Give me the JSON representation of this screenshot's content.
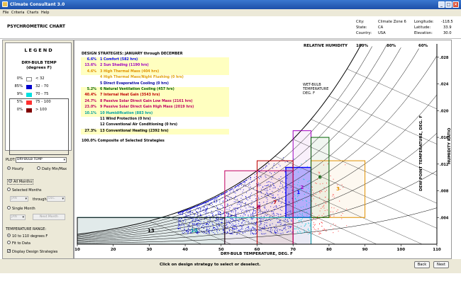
{
  "window": {
    "title": "Climate Consultant 3.0"
  },
  "menu": [
    "File",
    "Criteria",
    "Charts",
    "Help"
  ],
  "header": {
    "page_title": "PSYCHROMETRIC CHART",
    "city_label": "City:",
    "city": "Climate Zone 6",
    "state_label": "State:",
    "state": "CA",
    "country_label": "Country:",
    "country": "USA",
    "longitude_label": "Longitude:",
    "longitude": "-118.5",
    "latitude_label": "Latitude:",
    "latitude": "33.9",
    "elevation_label": "Elevation:",
    "elevation": "30.0"
  },
  "legend": {
    "title": "LEGEND",
    "subtitle1": "DRY-BULB TEMP",
    "subtitle2": "(degrees F)",
    "rows": [
      {
        "pct": "0%",
        "range": "< 32",
        "color": "#ffffff"
      },
      {
        "pct": "85%",
        "range": "32 - 70",
        "color": "#0000cc"
      },
      {
        "pct": "9%",
        "range": "70 - 75",
        "color": "#00e0e0"
      },
      {
        "pct": "5%",
        "range": "75 - 100",
        "color": "#ff3030"
      },
      {
        "pct": "0%",
        "range": "> 100",
        "color": "#800000"
      }
    ]
  },
  "controls": {
    "plot_label": "PLOT:",
    "plot_value": "DRY-BULB TEMP",
    "hourly": "Hourly",
    "daily": "Daily Min/Max",
    "all_months": "All Months",
    "selected_months": "Selected Months",
    "from_month": "JAN",
    "through": "through",
    "to_month": "DEC",
    "single_month": "Single Month",
    "single_value": "JAN",
    "next_month": "Next Month",
    "temp_range": "TEMPERATURE RANGE:",
    "range_fixed": "10 to 110 degrees F",
    "fit": "Fit to Data",
    "display_strategies": "Display Design Strategies"
  },
  "strategies": {
    "heading": "DESIGN STRATEGIES:  JANUARY through DECEMBER",
    "items": [
      {
        "pct": "6.6%",
        "label": "1  Comfort (582 hrs)",
        "color": "#0000ff",
        "bg": "#ffffc0"
      },
      {
        "pct": "13.6%",
        "label": "2  Sun Shading (1190 hrs)",
        "color": "#a000c0",
        "bg": "#ffffc0"
      },
      {
        "pct": "4.6%",
        "label": "3  High Thermal Mass (404 hrs)",
        "color": "#e09000",
        "bg": "#ffffc0"
      },
      {
        "pct": "",
        "label": "4  High Thermal Mass/Night Flushing (0 hrs)",
        "color": "#e0a000",
        "bg": "#ffffff"
      },
      {
        "pct": "",
        "label": "5  Direct Evaporative Cooling (0 hrs)",
        "color": "#0000a0",
        "bg": "#ffffff"
      },
      {
        "pct": "5.2%",
        "label": "6  Natural Ventilation Cooling (457 hrs)",
        "color": "#006000",
        "bg": "#ffffc0"
      },
      {
        "pct": "40.4%",
        "label": "7  Internal Heat Gain (3543 hrs)",
        "color": "#c00000",
        "bg": "#ffffc0"
      },
      {
        "pct": "24.7%",
        "label": "8  Passive Solar Direct Gain Low Mass (2161 hrs)",
        "color": "#c00060",
        "bg": "#ffffc0"
      },
      {
        "pct": "23.0%",
        "label": "9  Passive Solar Direct Gain High Mass (2019 hrs)",
        "color": "#c00060",
        "bg": "#ffffc0"
      },
      {
        "pct": "10.1%",
        "label": "10  Humidification (883 hrs)",
        "color": "#00a0a0",
        "bg": "#ffffc0"
      },
      {
        "pct": "",
        "label": "11  Wind Protection (0 hrs)",
        "color": "#000000",
        "bg": "#ffffff"
      },
      {
        "pct": "",
        "label": "12  Conventional Air Conditioning (0 hrs)",
        "color": "#000000",
        "bg": "#ffffff"
      },
      {
        "pct": "27.3%",
        "label": "13  Conventional Heating (2392 hrs)",
        "color": "#000000",
        "bg": "#ffffc0"
      }
    ],
    "composite": "100.0%  Composite of Selected Strategies"
  },
  "chart": {
    "rh_title": "RELATIVE HUMIDITY",
    "rh_100": "100%",
    "rh_80": "80%",
    "rh_60": "60%",
    "wb_label": "WET-BULB\nTEMPERATURE\nDEG. F",
    "dp_label": "DEW POINT TEMPERATURE, DEG. F",
    "hr_label": "HUMIDITY RATIO",
    "x_title": "DRY-BULB TEMPERATURE, DEG. F",
    "x_ticks": [
      "10",
      "20",
      "30",
      "40",
      "50",
      "60",
      "70",
      "80",
      "90",
      "100",
      "110"
    ],
    "hr_ticks": [
      ".028",
      ".024",
      ".020",
      ".016",
      ".012",
      ".008",
      ".004"
    ]
  },
  "chart_data": {
    "type": "scatter",
    "title": "PSYCHROMETRIC CHART",
    "xlabel": "DRY-BULB TEMPERATURE, DEG. F",
    "ylabel": "HUMIDITY RATIO",
    "xlim": [
      10,
      110
    ],
    "ylim": [
      0,
      0.03
    ],
    "x_ticks": [
      10,
      20,
      30,
      40,
      50,
      60,
      70,
      80,
      90,
      100,
      110
    ],
    "y_ticks": [
      0.004,
      0.008,
      0.012,
      0.016,
      0.02,
      0.024,
      0.028
    ],
    "rh_curves": [
      "100%",
      "90%",
      "80%",
      "70%",
      "60%",
      "50%",
      "40%",
      "30%",
      "20%",
      "10%"
    ],
    "series": [
      {
        "name": "32 - 70",
        "color": "#0000cc",
        "share": "85%"
      },
      {
        "name": "70 - 75",
        "color": "#00e0e0",
        "share": "9%"
      },
      {
        "name": "75 - 100",
        "color": "#ff3030",
        "share": "5%"
      }
    ],
    "zones": [
      {
        "id": "1",
        "name": "Comfort",
        "color": "#0000ff",
        "tdb": [
          68,
          75
        ],
        "w": [
          0.004,
          0.0115
        ]
      },
      {
        "id": "2",
        "name": "Sun Shading",
        "color": "#a000c0",
        "tdb": [
          70,
          75
        ],
        "w": [
          0,
          0.017
        ]
      },
      {
        "id": "3",
        "name": "High Thermal Mass",
        "color": "#e09000",
        "tdb": [
          75,
          90
        ],
        "w": [
          0.004,
          0.0125
        ]
      },
      {
        "id": "6",
        "name": "Natural Ventilation Cooling",
        "color": "#006000",
        "tdb": [
          75,
          80
        ],
        "w": [
          0.004,
          0.016
        ]
      },
      {
        "id": "7",
        "name": "Internal Heat Gain",
        "color": "#c00000",
        "tdb": [
          60,
          70
        ],
        "w": [
          0,
          0.0125
        ]
      },
      {
        "id": "8",
        "name": "Passive Solar Direct Gain Low Mass",
        "color": "#c00060",
        "tdb": [
          51,
          70
        ],
        "w": [
          0,
          0.011
        ]
      },
      {
        "id": "10",
        "name": "Humidification",
        "color": "#00a0a0",
        "tdb": [
          10,
          75
        ],
        "w": [
          0,
          0.004
        ]
      },
      {
        "id": "13",
        "name": "Conventional Heating",
        "color": "#000000",
        "tdb": [
          10,
          51
        ],
        "w": [
          0,
          0.004
        ]
      }
    ]
  },
  "footer": {
    "message": "Click on design strategy to select or deselect.",
    "back": "Back",
    "next": "Next"
  }
}
